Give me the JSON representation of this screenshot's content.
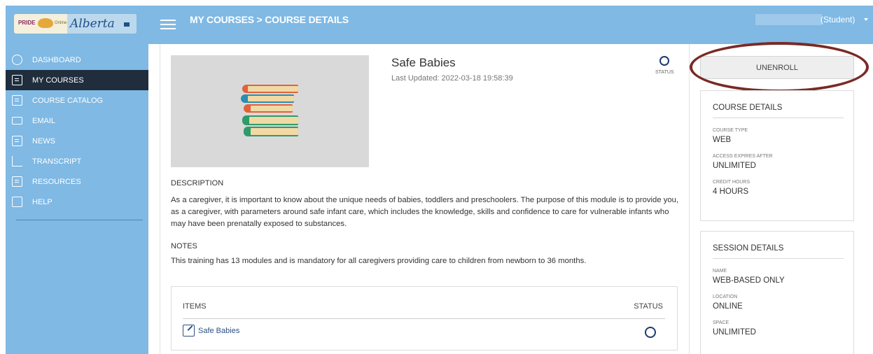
{
  "header": {
    "logo": {
      "pride_text": "PRIDE",
      "online_text": "Online",
      "alberta_text": "Alberta"
    },
    "breadcrumb": "MY COURSES  >  COURSE DETAILS",
    "user_role": "(Student)"
  },
  "sidebar": {
    "items": [
      {
        "label": "DASHBOARD",
        "icon": "dashboard-icon",
        "active": false
      },
      {
        "label": "MY COURSES",
        "icon": "my-courses-icon",
        "active": true
      },
      {
        "label": "COURSE CATALOG",
        "icon": "catalog-icon",
        "active": false
      },
      {
        "label": "EMAIL",
        "icon": "envelope-icon",
        "active": false
      },
      {
        "label": "NEWS",
        "icon": "news-icon",
        "active": false
      },
      {
        "label": "TRANSCRIPT",
        "icon": "transcript-chart-icon",
        "active": false
      },
      {
        "label": "RESOURCES",
        "icon": "download-icon",
        "active": false
      },
      {
        "label": "HELP",
        "icon": "help-chat-icon",
        "active": false
      }
    ]
  },
  "course": {
    "title": "Safe Babies",
    "last_updated": "Last Updated: 2022-03-18 19:58:39",
    "status_label": "STATUS",
    "description_heading": "DESCRIPTION",
    "description": "As a caregiver, it is important to know about the unique needs of babies, toddlers and preschoolers. The purpose of this module is to provide you, as a caregiver, with parameters around safe infant care, which includes the knowledge, skills and confidence to care for vulnerable infants who may have been prenatally exposed to substances.",
    "notes_heading": "NOTES",
    "notes": "This training has 13 modules and is mandatory for all caregivers providing care to children from newborn to 36 months.",
    "items_heading": "ITEMS",
    "items_status_heading": "STATUS",
    "items": [
      {
        "label": "Safe Babies"
      }
    ]
  },
  "actions": {
    "unenroll_label": "UNENROLL"
  },
  "course_details": {
    "title": "COURSE DETAILS",
    "fields": [
      {
        "label": "COURSE TYPE",
        "value": "WEB"
      },
      {
        "label": "ACCESS EXPIRES AFTER",
        "value": "UNLIMITED"
      },
      {
        "label": "CREDIT HOURS",
        "value": "4 HOURS"
      }
    ]
  },
  "session_details": {
    "title": "SESSION DETAILS",
    "fields": [
      {
        "label": "NAME",
        "value": "WEB-BASED ONLY"
      },
      {
        "label": "LOCATION",
        "value": "ONLINE"
      },
      {
        "label": "SPACE",
        "value": "UNLIMITED"
      }
    ]
  },
  "colors": {
    "brand_blue": "#7fb9e4",
    "active_nav": "#1f2d3d",
    "link_blue": "#2c4f84",
    "highlight_oval": "#7a2a25"
  }
}
